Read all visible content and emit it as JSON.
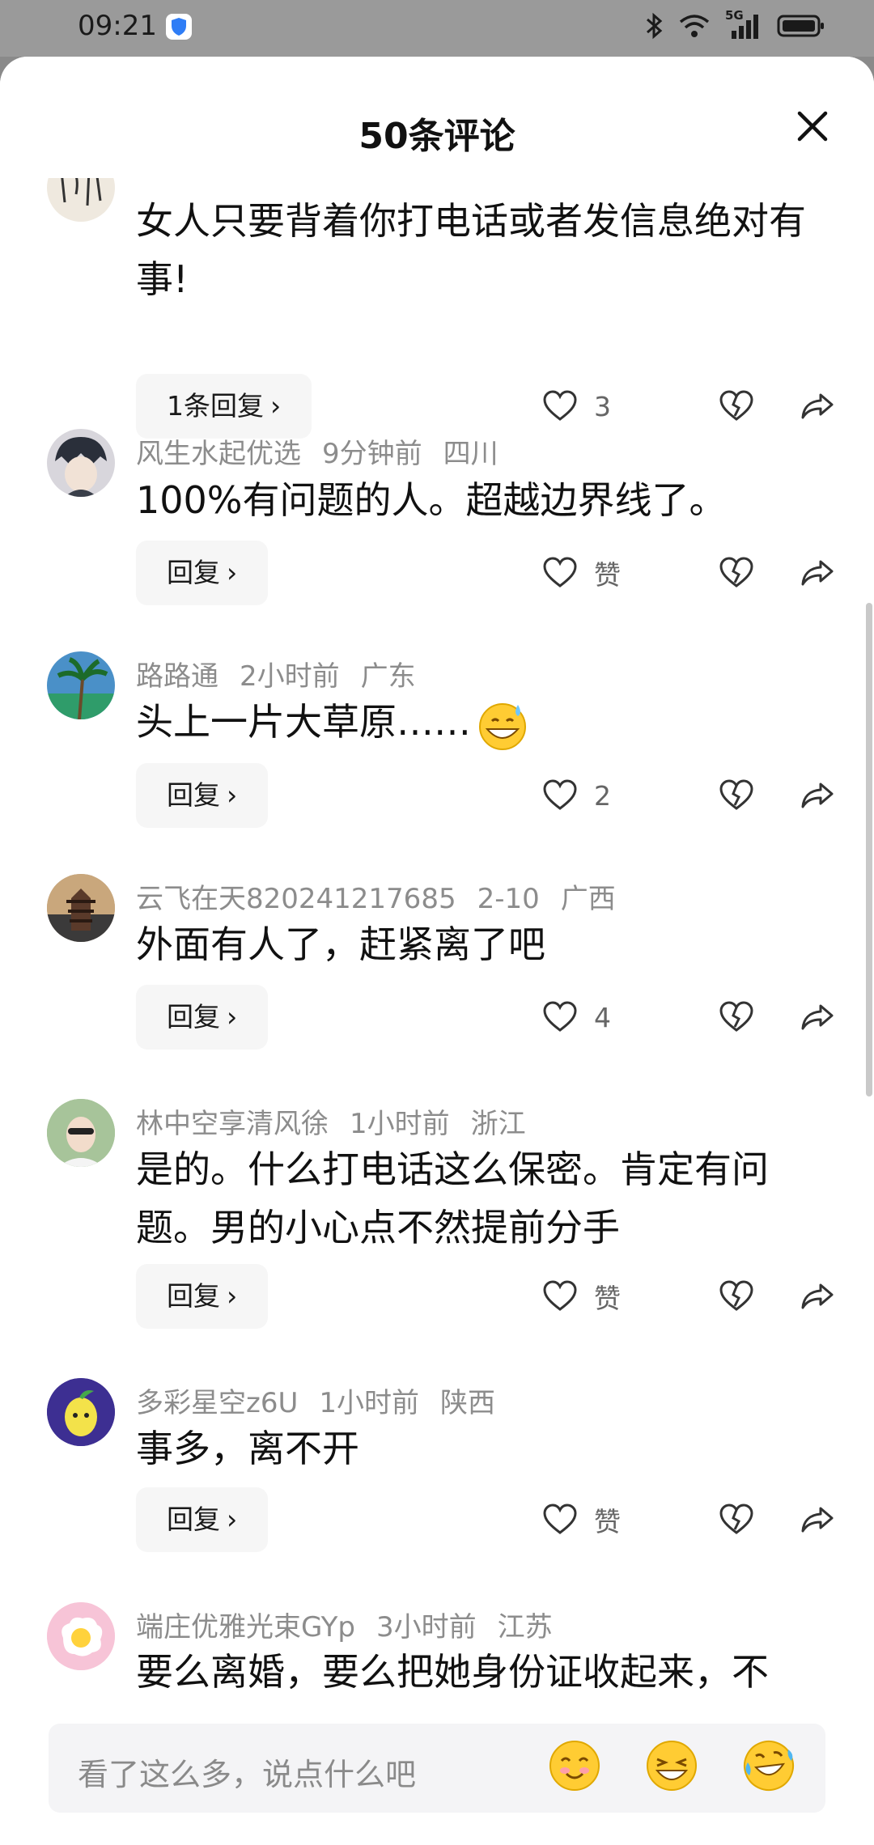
{
  "status_bar": {
    "time": "09:21",
    "network": "5G"
  },
  "sheet": {
    "title": "50条评论"
  },
  "comments": [
    {
      "user": "",
      "time": "",
      "region": "",
      "text": "女人只要背着你打电话或者发信息绝对有事!",
      "reply_label": "1条回复",
      "likes": "3"
    },
    {
      "user": "风生水起优选",
      "time": "9分钟前",
      "region": "四川",
      "text": "100%有问题的人。超越边界线了。",
      "reply_label": "回复",
      "likes": "赞"
    },
    {
      "user": "路路通",
      "time": "2小时前",
      "region": "广东",
      "text": "头上一片大草原……",
      "reply_label": "回复",
      "likes": "2"
    },
    {
      "user": "云飞在天820241217685",
      "time": "2-10",
      "region": "广西",
      "text": "外面有人了，赶紧离了吧",
      "reply_label": "回复",
      "likes": "4"
    },
    {
      "user": "林中空享清风徐",
      "time": "1小时前",
      "region": "浙江",
      "text": "是的。什么打电话这么保密。肯定有问题。男的小心点不然提前分手",
      "reply_label": "回复",
      "likes": "赞"
    },
    {
      "user": "多彩星空z6U",
      "time": "1小时前",
      "region": "陕西",
      "text": "事多，离不开",
      "reply_label": "回复",
      "likes": "赞"
    },
    {
      "user": "端庄优雅光束GYp",
      "time": "3小时前",
      "region": "江苏",
      "text": "要么离婚，要么把她身份证收起来，不",
      "reply_label": "",
      "likes": ""
    }
  ],
  "input": {
    "placeholder": "看了这么多，说点什么吧"
  },
  "icons": {
    "like": "heart-outline-icon",
    "dislike": "broken-heart-icon",
    "share": "share-arrow-icon",
    "close": "close-icon"
  }
}
